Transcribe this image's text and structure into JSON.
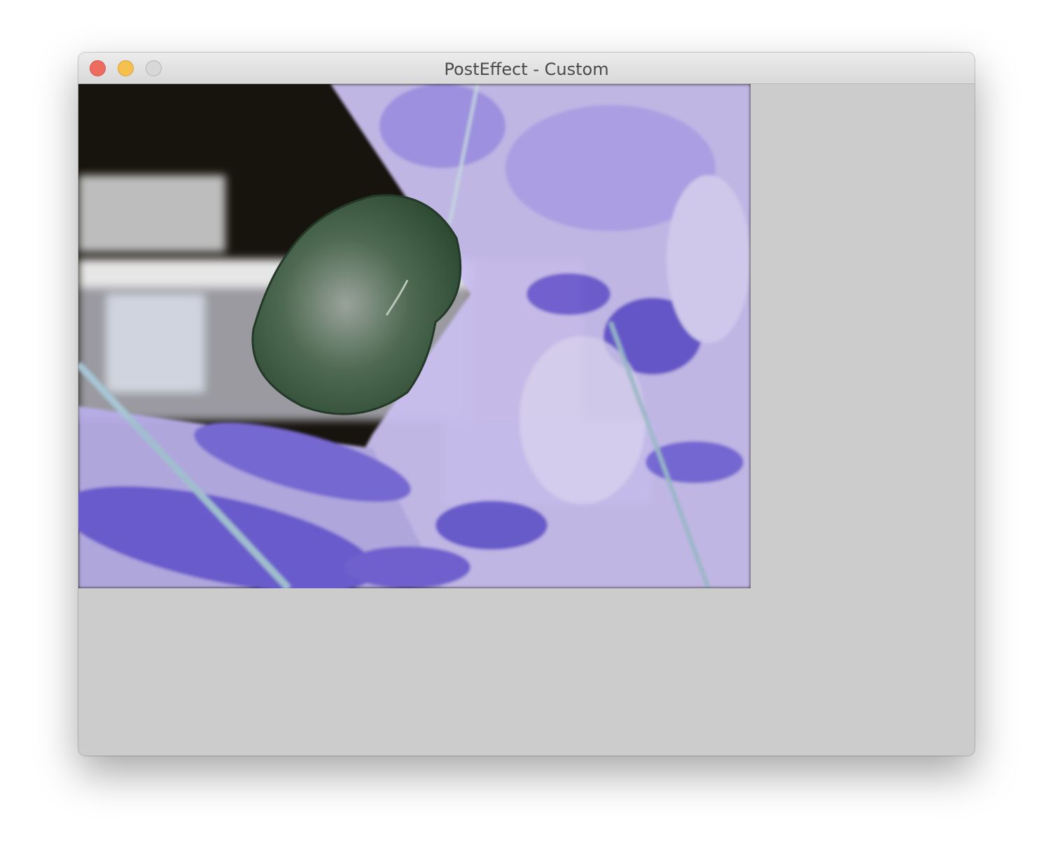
{
  "window": {
    "title": "PostEffect - Custom",
    "buttons": [
      "close",
      "minimize",
      "zoom"
    ]
  },
  "colors": {
    "content_background": "#cccccc",
    "close": "#ee6b60",
    "minimize": "#f6c04f",
    "zoom": "#d8d8d8"
  }
}
